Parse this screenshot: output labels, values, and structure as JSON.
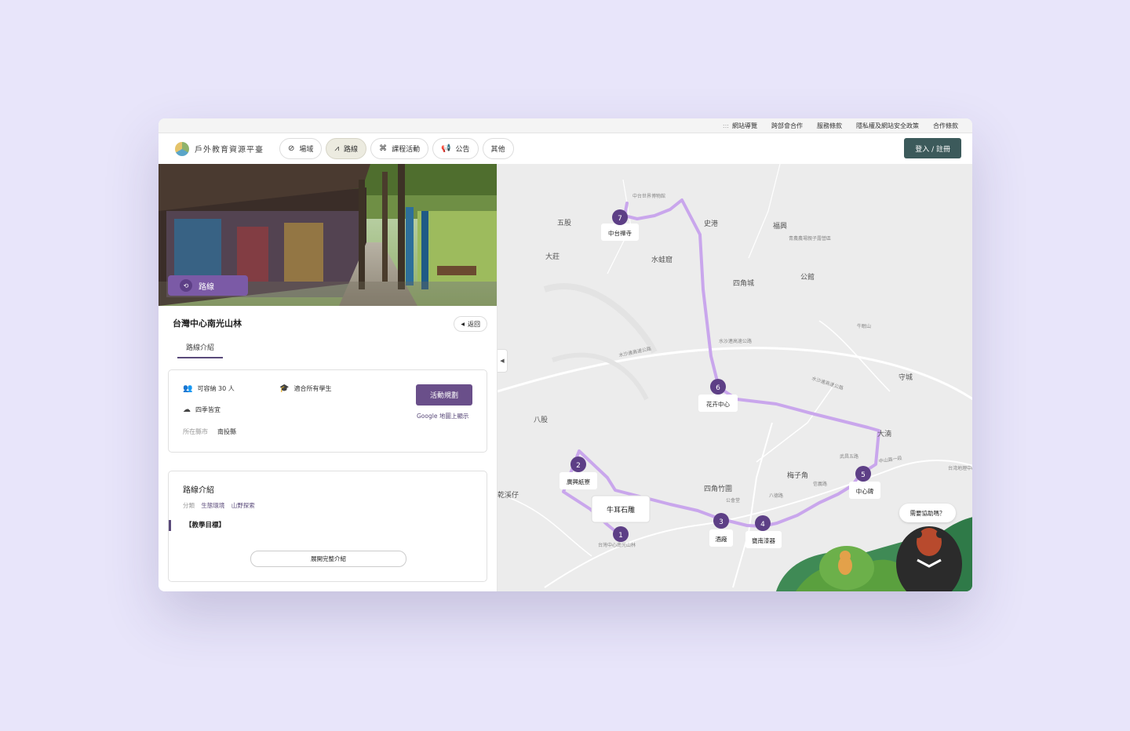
{
  "utility_links": [
    "網站導覽",
    "跨部會合作",
    "服務條款",
    "隱私權及網站安全政策",
    "合作條款"
  ],
  "logo_text": "戶外教育資源平臺",
  "nav": [
    {
      "label": "場域",
      "icon": "compass-icon"
    },
    {
      "label": "路線",
      "icon": "trend-icon",
      "active": true
    },
    {
      "label": "課程活動",
      "icon": "command-icon"
    },
    {
      "label": "公告",
      "icon": "megaphone-icon"
    },
    {
      "label": "其他"
    }
  ],
  "login_label": "登入 / 註冊",
  "hero_badge": "路線",
  "site_title": "台灣中心南光山林",
  "back_label": "返回",
  "tab_label": "路線介紹",
  "info": {
    "capacity": "可容納 30 人",
    "audience": "適合所有學生",
    "season": "四季皆宜",
    "county_label": "所在縣市",
    "county": "南投縣",
    "plan_button": "活動規劃",
    "map_link": "Google 地圖上顯示"
  },
  "intro": {
    "title": "路線介紹",
    "category_label": "分類",
    "tags": [
      "生態環境",
      "山野探索"
    ],
    "goal": "【教學目標】",
    "expand_label": "展開完整介紹"
  },
  "map": {
    "place_labels": [
      "五股",
      "大莊",
      "史港",
      "福興",
      "水蛙窟",
      "四角城",
      "公館",
      "守城",
      "八股",
      "乾溪仔",
      "四角竹圍",
      "梅子角",
      "大湳"
    ],
    "minor_labels": [
      "中台世界博物館",
      "青農農場親子露營區",
      "牛眠山",
      "水沙連高速公路",
      "水沙連高速公路",
      "水沙連高速公路",
      "台灣中心南光山林",
      "中山路一段",
      "公會堂",
      "八德路",
      "信義路",
      "武昌五路",
      "台湾地理中心碑"
    ],
    "stops": [
      {
        "n": "1",
        "label": "牛耳石雕"
      },
      {
        "n": "2",
        "label": "廣興紙寮"
      },
      {
        "n": "3",
        "label": "酒廠"
      },
      {
        "n": "4",
        "label": "甕南漆器"
      },
      {
        "n": "5",
        "label": "中心碑"
      },
      {
        "n": "6",
        "label": "花卉中心"
      },
      {
        "n": "7",
        "label": "中台禪寺"
      }
    ],
    "help_label": "需要協助嗎？",
    "route_color": "#c9a6ec",
    "marker_color": "#5d3f86"
  }
}
